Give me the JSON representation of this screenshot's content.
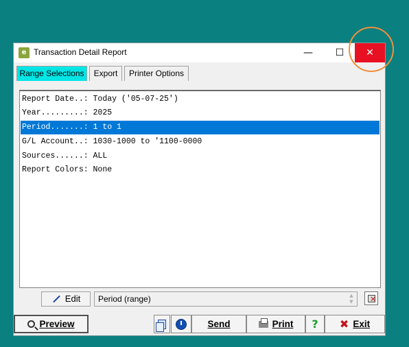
{
  "window": {
    "title": "Transaction Detail Report",
    "app_icon_text": "e",
    "minimize_glyph": "—",
    "maximize_glyph": "☐",
    "close_glyph": "✕"
  },
  "tabs": [
    {
      "label": "Range Selections",
      "active": true
    },
    {
      "label": "Export",
      "active": false
    },
    {
      "label": "Printer Options",
      "active": false
    }
  ],
  "list": {
    "rows": [
      {
        "text": "Report Date..: Today ('05-07-25')",
        "selected": false
      },
      {
        "text": "Year.........: 2025",
        "selected": false
      },
      {
        "text": "Period.......: 1 to 1",
        "selected": true
      },
      {
        "text": "G/L Account..: 1030-1000 to '1100-0000",
        "selected": false
      },
      {
        "text": "Sources......: ALL",
        "selected": false
      },
      {
        "text": "Report Colors: None",
        "selected": false
      }
    ]
  },
  "edit_button": {
    "label": "Edit",
    "icon": "pencil-icon"
  },
  "status_field": {
    "value": "Period (range)"
  },
  "bottom_buttons": {
    "preview": "Preview",
    "send": "Send",
    "print": "Print",
    "help": "?",
    "exit": "Exit"
  },
  "colors": {
    "desktop": "#0b8080",
    "active_tab": "#00e6e6",
    "selection": "#0078d7",
    "close_button": "#e81123",
    "highlight_ring": "#f0903a"
  }
}
